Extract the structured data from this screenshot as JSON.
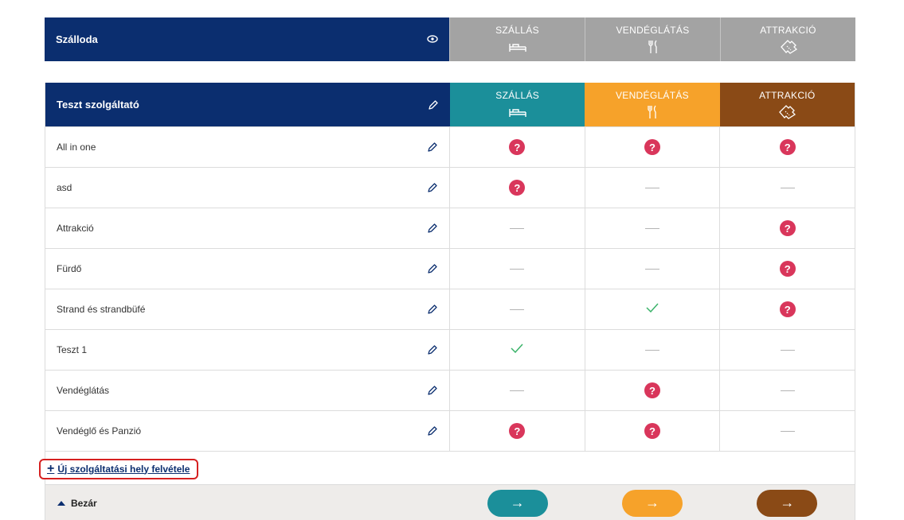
{
  "summary": {
    "title": "Szálloda"
  },
  "categories": [
    {
      "label": "SZÁLLÁS",
      "icon": "bed-icon"
    },
    {
      "label": "VENDÉGLÁTÁS",
      "icon": "fork-knife-icon"
    },
    {
      "label": "ATTRAKCIÓ",
      "icon": "ticket-icon"
    }
  ],
  "table": {
    "title": "Teszt szolgáltató",
    "rows": [
      {
        "name": "All in one",
        "cells": [
          "question",
          "question",
          "question"
        ]
      },
      {
        "name": "asd",
        "cells": [
          "question",
          "none",
          "none"
        ]
      },
      {
        "name": "Attrakció",
        "cells": [
          "none",
          "none",
          "question"
        ]
      },
      {
        "name": "Fürdő",
        "cells": [
          "none",
          "none",
          "question"
        ]
      },
      {
        "name": "Strand és strandbüfé",
        "cells": [
          "none",
          "check",
          "question"
        ]
      },
      {
        "name": "Teszt 1",
        "cells": [
          "check",
          "none",
          "none"
        ]
      },
      {
        "name": "Vendéglátás",
        "cells": [
          "none",
          "question",
          "none"
        ]
      },
      {
        "name": "Vendéglő és Panzió",
        "cells": [
          "question",
          "question",
          "none"
        ]
      }
    ]
  },
  "add_link": {
    "label": "Új szolgáltatási hely felvétele"
  },
  "footer": {
    "close_label": "Bezár"
  },
  "colors": {
    "navy": "#0b2e6f",
    "grey": "#a3a3a3",
    "szallas": "#1b8f9a",
    "vendeglatas": "#f6a22a",
    "attrakcio": "#8a4a16",
    "question": "#d9365b",
    "check": "#3bb36a"
  }
}
